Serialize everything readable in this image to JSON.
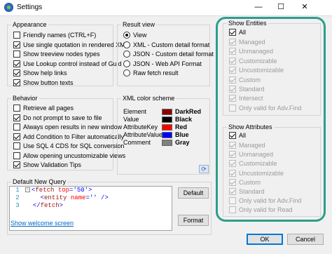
{
  "window": {
    "title": "Settings",
    "minimize": "—",
    "maximize": "☐",
    "close": "✕"
  },
  "appearance": {
    "title": "Appearance",
    "items": [
      {
        "label": "Friendly names (CTRL+F)",
        "checked": false
      },
      {
        "label": "Use single quotation in rendered XML",
        "checked": true
      },
      {
        "label": "Show treeview nodes types",
        "checked": false
      },
      {
        "label": "Use Lookup control instead of Guid",
        "checked": true
      },
      {
        "label": "Show help links",
        "checked": true
      },
      {
        "label": "Show button texts",
        "checked": true
      }
    ]
  },
  "result_view": {
    "title": "Result view",
    "options": [
      {
        "label": "View",
        "checked": true
      },
      {
        "label": "XML - Custom detail format",
        "checked": false
      },
      {
        "label": "JSON - Custom detail format",
        "checked": false
      },
      {
        "label": "JSON - Web API Format",
        "checked": false
      },
      {
        "label": "Raw fetch result",
        "checked": false
      }
    ]
  },
  "behavior": {
    "title": "Behavior",
    "items": [
      {
        "label": "Retrieve all pages",
        "checked": false
      },
      {
        "label": "Do not prompt to save to file",
        "checked": true
      },
      {
        "label": "Always open results in new window",
        "checked": false
      },
      {
        "label": "Add Condition to Filter automatically",
        "checked": true
      },
      {
        "label": "Use SQL 4 CDS for SQL conversion",
        "checked": false
      },
      {
        "label": "Allow opening uncustomizable views",
        "checked": false
      },
      {
        "label": "Show Validation Tips",
        "checked": true
      }
    ]
  },
  "xml_color_scheme": {
    "title": "XML color scheme",
    "entries": [
      {
        "name": "Element",
        "value": "DarkRed",
        "color": "#8b0000"
      },
      {
        "name": "Value",
        "value": "Black",
        "color": "#000000"
      },
      {
        "name": "AttributeKey",
        "value": "Red",
        "color": "#ff0000"
      },
      {
        "name": "AttributeValue",
        "value": "Blue",
        "color": "#0000ff"
      },
      {
        "name": "Comment",
        "value": "Gray",
        "color": "#808080"
      }
    ],
    "reset_icon": "refresh-icon",
    "reset_glyph": "⟳"
  },
  "default_query": {
    "title": "Default New Query",
    "line_numbers": [
      "1",
      "2",
      "3"
    ],
    "line1": {
      "open": "<",
      "tag": "fetch",
      "attr": " top",
      "eq": "=",
      "val": "'50'",
      "close": ">"
    },
    "line2": {
      "open": "<",
      "tag": "entity",
      "attr": " name",
      "eq": "=",
      "val": "''",
      "close": " />"
    },
    "line3": {
      "open": "</",
      "tag": "fetch",
      "close": ">"
    },
    "fold_glyph": "−",
    "default_button": "Default",
    "format_button": "Format"
  },
  "show_entities": {
    "title": "Show Entities",
    "all": {
      "label": "All",
      "checked": true
    },
    "items": [
      {
        "label": "Managed",
        "checked": true
      },
      {
        "label": "Unmanaged",
        "checked": true
      },
      {
        "label": "Customizable",
        "checked": true
      },
      {
        "label": "Uncustomizable",
        "checked": true
      },
      {
        "label": "Custom",
        "checked": true
      },
      {
        "label": "Standard",
        "checked": true
      },
      {
        "label": "Intersect",
        "checked": true
      },
      {
        "label": "Only valid for Adv.Find",
        "checked": false
      }
    ]
  },
  "show_attributes": {
    "title": "Show Attributes",
    "all": {
      "label": "All",
      "checked": true
    },
    "items": [
      {
        "label": "Managed",
        "checked": true
      },
      {
        "label": "Unmanaged",
        "checked": true
      },
      {
        "label": "Customizable",
        "checked": true
      },
      {
        "label": "Uncustomizable",
        "checked": true
      },
      {
        "label": "Custom",
        "checked": true
      },
      {
        "label": "Standard",
        "checked": true
      },
      {
        "label": "Only valid for Adv.Find",
        "checked": false
      },
      {
        "label": "Only valid for Read",
        "checked": false
      }
    ]
  },
  "footer": {
    "welcome_link": "Show welcome screen",
    "ok": "OK",
    "cancel": "Cancel"
  },
  "colors": {
    "highlight": "#2e9d8c",
    "link": "#0066cc"
  }
}
